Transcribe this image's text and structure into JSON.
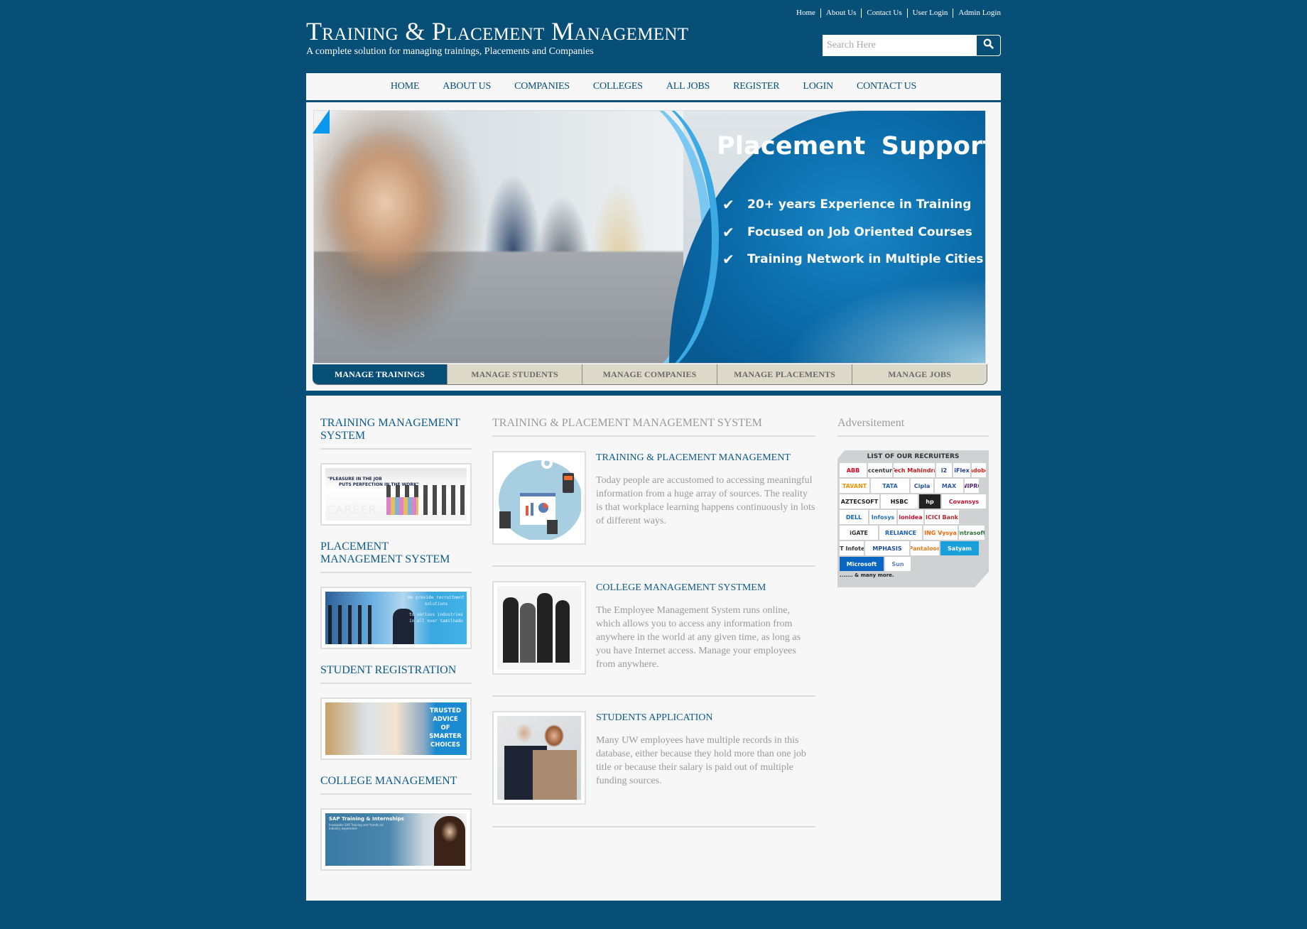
{
  "header": {
    "title": "Training & Placement Management",
    "tagline": "A complete solution for managing trainings, Placements and Companies",
    "top_links": [
      "Home",
      "About Us",
      "Contact Us",
      "User Login",
      "Admin Login"
    ],
    "search": {
      "placeholder": "Search Here",
      "value": "",
      "button_icon": "search-icon"
    }
  },
  "nav": {
    "items": [
      "HOME",
      "ABOUT US",
      "COMPANIES",
      "COLLEGES",
      "ALL JOBS",
      "REGISTER",
      "LOGIN",
      "CONTACT US"
    ]
  },
  "banner": {
    "heading": "Placement  Support",
    "points": [
      "20+ years Experience in Training",
      "Focused on Job Oriented Courses",
      "Training Network in Multiple Cities"
    ],
    "point_icon": "check-icon",
    "tabs": [
      {
        "label": "MANAGE TRAININGS",
        "active": true
      },
      {
        "label": "MANAGE STUDENTS",
        "active": false
      },
      {
        "label": "MANAGE COMPANIES",
        "active": false
      },
      {
        "label": "MANAGE PLACEMENTS",
        "active": false
      },
      {
        "label": "MANAGE JOBS",
        "active": false
      }
    ]
  },
  "sidebar": {
    "sections": [
      {
        "heading": "TRAINING MANAGEMENT SYSTEM",
        "image": {
          "quote_line1": "\"PLEASURE IN THE JOB",
          "quote_line2": "PUTS PERFECTION IN THE WORK\"",
          "word": "CAREER..."
        }
      },
      {
        "heading": "PLACEMENT MANAGEMENT SYSTEM",
        "image": {
          "line1": "We provide recruitment solutions",
          "line2": "to various industries in all over tamilnadu"
        }
      },
      {
        "heading": "STUDENT REGISTRATION",
        "image": {
          "text": "TRUSTED ADVICE OF SMARTER CHOICES"
        }
      },
      {
        "heading": "COLLEGE MANAGEMENT",
        "image": {
          "title": "SAP Training & Internships",
          "subtitle": "Invaluable SAP Training and 'hands on' industry experience"
        }
      }
    ]
  },
  "main": {
    "heading": "TRAINING & PLACEMENT MANAGEMENT SYSTEM",
    "articles": [
      {
        "title": "TRAINING & PLACEMENT MANAGEMENT",
        "text": "Today people are accustomed to accessing meaningful information from a huge array of sources. The reality is that workplace learning happens continuously in lots of different ways."
      },
      {
        "title": "COLLEGE MANAGEMENT SYSTMEM",
        "text": "The Employee Management System runs online, which allows you to access any information from anywhere in the world at any given time, as long as you have Internet access. Manage your employees from anywhere."
      },
      {
        "title": "STUDENTS APPLICATION",
        "text": "Many UW employees have multiple records in this database, either because they hold more than one job title or because their salary is paid out of multiple funding sources."
      }
    ]
  },
  "advertisement": {
    "heading": "Adversitement",
    "title": "LIST OF OUR RECRUITERS",
    "logos": [
      {
        "name": "ABB",
        "color": "#e2001a"
      },
      {
        "name": "accenture",
        "color": "#333333"
      },
      {
        "name": "Tech Mahindra",
        "color": "#c4161c"
      },
      {
        "name": "i2",
        "color": "#223a8f"
      },
      {
        "name": "iFlex",
        "color": "#1c3f94"
      },
      {
        "name": "Adobe",
        "color": "#e2231a"
      },
      {
        "name": "TAVANT",
        "color": "#f39200"
      },
      {
        "name": "TATA",
        "color": "#1f64a8"
      },
      {
        "name": "Cipla",
        "color": "#1f4e9c"
      },
      {
        "name": "MAX",
        "color": "#2e5aa8"
      },
      {
        "name": "WIPRO",
        "color": "#5b2a86"
      },
      {
        "name": "AZTECSOFT",
        "color": "#222222"
      },
      {
        "name": "HSBC",
        "color": "#111111"
      },
      {
        "name": "hp",
        "color": "#ffffff"
      },
      {
        "name": "Covansys",
        "color": "#c8102e"
      },
      {
        "name": "DELL",
        "color": "#0a5fb4"
      },
      {
        "name": "Infosys",
        "color": "#1d6fb8"
      },
      {
        "name": "ionidea",
        "color": "#c8102e"
      },
      {
        "name": "ICICI Bank",
        "color": "#b02a30"
      },
      {
        "name": "iGATE",
        "color": "#333333"
      },
      {
        "name": "RELIANCE",
        "color": "#1d5fb0"
      },
      {
        "name": "ING Vysya",
        "color": "#ff6200"
      },
      {
        "name": "Intrasoft",
        "color": "#2f6d3a"
      },
      {
        "name": "L&T Infotech",
        "color": "#333333"
      },
      {
        "name": "MPHASIS",
        "color": "#1d4c9c"
      },
      {
        "name": "Pantaloon",
        "color": "#e07b1a"
      },
      {
        "name": "Satyam",
        "color": "#ffffff"
      },
      {
        "name": "Microsoft",
        "color": "#ffffff"
      },
      {
        "name": "Sun",
        "color": "#5b7fb5"
      }
    ],
    "more_text": "....... & many more."
  },
  "colors": {
    "brand": "#084f78",
    "link": "#0c5a8a",
    "muted_text": "#9a9a9a",
    "panel_bg": "#f7f7f7",
    "tab_bg": "#ddd9c9",
    "banner_blue": "#0a6aa8"
  }
}
